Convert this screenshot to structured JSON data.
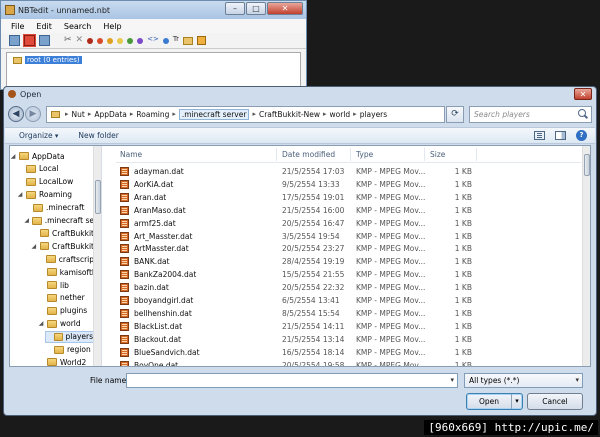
{
  "nbt": {
    "title": "NBTedit - unnamed.nbt",
    "menu": [
      "File",
      "Edit",
      "Search",
      "Help"
    ],
    "toolbar_text": "Tr",
    "root_label": "root (0 entries)"
  },
  "dialog": {
    "title": "Open",
    "breadcrumbs": [
      "Nut",
      "AppData",
      "Roaming",
      ".minecraft server",
      "CraftBukkit-New",
      "world",
      "players"
    ],
    "search_placeholder": "Search players",
    "organize_label": "Organize",
    "new_folder_label": "New folder",
    "nav_tree": [
      {
        "label": "AppData",
        "indent": 0,
        "arrow": "◢"
      },
      {
        "label": "Local",
        "indent": 1,
        "arrow": ""
      },
      {
        "label": "LocalLow",
        "indent": 1,
        "arrow": ""
      },
      {
        "label": "Roaming",
        "indent": 1,
        "arrow": "◢"
      },
      {
        "label": ".minecraft",
        "indent": 2,
        "arrow": ""
      },
      {
        "label": ".minecraft se",
        "indent": 2,
        "arrow": "◢"
      },
      {
        "label": "CraftBukkit",
        "indent": 3,
        "arrow": ""
      },
      {
        "label": "CraftBukkit",
        "indent": 3,
        "arrow": "◢"
      },
      {
        "label": "craftscrip",
        "indent": 4,
        "arrow": ""
      },
      {
        "label": "kamisoftl",
        "indent": 4,
        "arrow": ""
      },
      {
        "label": "lib",
        "indent": 4,
        "arrow": ""
      },
      {
        "label": "nether",
        "indent": 4,
        "arrow": ""
      },
      {
        "label": "plugins",
        "indent": 4,
        "arrow": ""
      },
      {
        "label": "world",
        "indent": 4,
        "arrow": "◢"
      },
      {
        "label": "players",
        "indent": 5,
        "arrow": "",
        "selected": true
      },
      {
        "label": "region",
        "indent": 5,
        "arrow": ""
      },
      {
        "label": "World2",
        "indent": 4,
        "arrow": ""
      }
    ],
    "columns": {
      "name": "Name",
      "date": "Date modified",
      "type": "Type",
      "size": "Size"
    },
    "files": [
      {
        "name": "adayman.dat",
        "date": "21/5/2554 17:03",
        "type": "KMP - MPEG Mov...",
        "size": "1 KB"
      },
      {
        "name": "AorKiA.dat",
        "date": "9/5/2554 13:33",
        "type": "KMP - MPEG Mov...",
        "size": "1 KB"
      },
      {
        "name": "Aran.dat",
        "date": "17/5/2554 19:01",
        "type": "KMP - MPEG Mov...",
        "size": "1 KB"
      },
      {
        "name": "AranMaso.dat",
        "date": "21/5/2554 16:00",
        "type": "KMP - MPEG Mov...",
        "size": "1 KB"
      },
      {
        "name": "armf25.dat",
        "date": "20/5/2554 16:47",
        "type": "KMP - MPEG Mov...",
        "size": "1 KB"
      },
      {
        "name": "Art_Masster.dat",
        "date": "3/5/2554 19:54",
        "type": "KMP - MPEG Mov...",
        "size": "1 KB"
      },
      {
        "name": "ArtMasster.dat",
        "date": "20/5/2554 23:27",
        "type": "KMP - MPEG Mov...",
        "size": "1 KB"
      },
      {
        "name": "BANK.dat",
        "date": "28/4/2554 19:19",
        "type": "KMP - MPEG Mov...",
        "size": "1 KB"
      },
      {
        "name": "BankZa2004.dat",
        "date": "15/5/2554 21:55",
        "type": "KMP - MPEG Mov...",
        "size": "1 KB"
      },
      {
        "name": "bazin.dat",
        "date": "20/5/2554 22:32",
        "type": "KMP - MPEG Mov...",
        "size": "1 KB"
      },
      {
        "name": "bboyandgirl.dat",
        "date": "6/5/2554 13:41",
        "type": "KMP - MPEG Mov...",
        "size": "1 KB"
      },
      {
        "name": "bellhenshin.dat",
        "date": "8/5/2554 15:54",
        "type": "KMP - MPEG Mov...",
        "size": "1 KB"
      },
      {
        "name": "BlackList.dat",
        "date": "21/5/2554 14:11",
        "type": "KMP - MPEG Mov...",
        "size": "1 KB"
      },
      {
        "name": "Blackout.dat",
        "date": "21/5/2554 13:14",
        "type": "KMP - MPEG Mov...",
        "size": "1 KB"
      },
      {
        "name": "BlueSandvich.dat",
        "date": "16/5/2554 18:14",
        "type": "KMP - MPEG Mov...",
        "size": "1 KB"
      },
      {
        "name": "BoyOne.dat",
        "date": "20/5/2554 19:58",
        "type": "KMP - MPEG Mov...",
        "size": "1 KB"
      }
    ],
    "filename_label": "File name:",
    "filename_value": "",
    "filetype_value": "All types (*.*)",
    "open_label": "Open",
    "cancel_label": "Cancel"
  },
  "watermark": "[960x669] http://upic.me/",
  "colors": {
    "selection": "#3c7fd8",
    "close_red": "#c2402e",
    "dialog_frame": "#cfdcec"
  }
}
